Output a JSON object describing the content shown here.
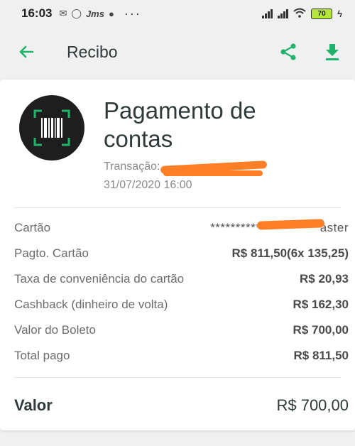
{
  "status_bar": {
    "time": "16:03",
    "battery_level": "70",
    "left_icons": [
      "mail-icon",
      "whatsapp-icon",
      "jms-icon",
      "app-icon"
    ],
    "more": "···"
  },
  "app_bar": {
    "title": "Recibo",
    "accent_color": "#1fb36b"
  },
  "receipt": {
    "title": "Pagamento de contas",
    "transaction_label": "Transação: ",
    "date": "31/07/2020 16:00",
    "rows": [
      {
        "label": "Cartão",
        "value": "*************",
        "value_suffix": "aster"
      },
      {
        "label": "Pagto. Cartão",
        "value": "R$ 811,50(6x 135,25)"
      },
      {
        "label": "Taxa de conveniência do cartão",
        "value": "R$ 20,93"
      },
      {
        "label": "Cashback (dinheiro de volta)",
        "value": "R$ 162,30"
      },
      {
        "label": "Valor do Boleto",
        "value": "R$ 700,00"
      },
      {
        "label": "Total pago",
        "value": "R$ 811,50"
      }
    ],
    "total_label": "Valor",
    "total_value": "R$ 700,00"
  }
}
